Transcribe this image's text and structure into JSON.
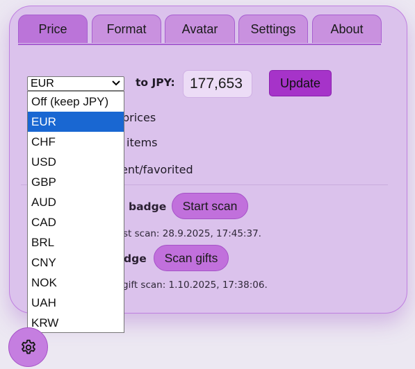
{
  "tabs": [
    {
      "label": "Price",
      "active": true
    },
    {
      "label": "Format",
      "active": false
    },
    {
      "label": "Avatar",
      "active": false
    },
    {
      "label": "Settings",
      "active": false
    },
    {
      "label": "About",
      "active": false
    }
  ],
  "price": {
    "selected_currency": "EUR",
    "to_label": "to JPY:",
    "rate_value": "177,653",
    "update_label": "Update"
  },
  "options": {
    "opt1_label": "prices",
    "opt2_label": "items",
    "opt3_label": "ent/favorited"
  },
  "scan": {
    "badge1_label": "badge",
    "start_scan_label": "Start scan",
    "last_scan_text": "st scan: 28.9.2025, 17:45:37.",
    "badge2_label": "dge",
    "scan_gifts_label": "Scan gifts",
    "gift_scan_text": "gift scan: 1.10.2025, 17:38:06."
  },
  "currency_options": [
    {
      "label": "Off (keep JPY)",
      "selected": false
    },
    {
      "label": "EUR",
      "selected": true
    },
    {
      "label": "CHF",
      "selected": false
    },
    {
      "label": "USD",
      "selected": false
    },
    {
      "label": "GBP",
      "selected": false
    },
    {
      "label": "AUD",
      "selected": false
    },
    {
      "label": "CAD",
      "selected": false
    },
    {
      "label": "BRL",
      "selected": false
    },
    {
      "label": "CNY",
      "selected": false
    },
    {
      "label": "NOK",
      "selected": false
    },
    {
      "label": "UAH",
      "selected": false
    },
    {
      "label": "KRW",
      "selected": false
    }
  ],
  "icons": {
    "select_chevron": "chevron-down-icon",
    "fab": "gear-icon"
  },
  "colors": {
    "panel_bg": "#dbc2ec",
    "accent": "#a633c9",
    "tab_bg": "#c991df",
    "selected_option": "#1967d2"
  }
}
